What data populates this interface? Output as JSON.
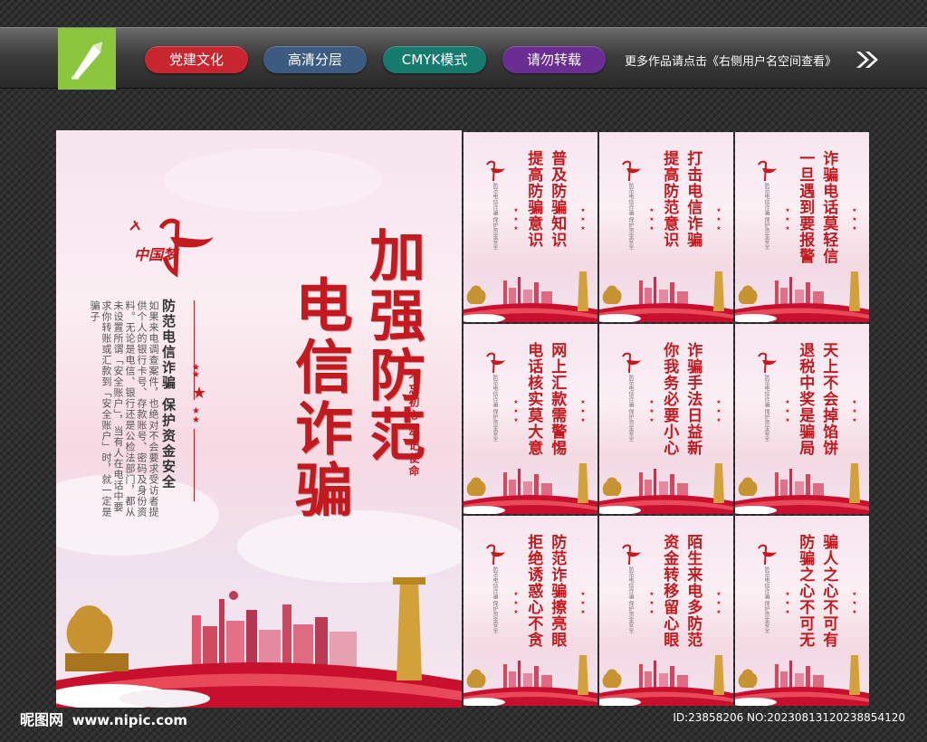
{
  "header": {
    "tags": [
      "党建文化",
      "高清分层",
      "CMYK模式",
      "请勿转载"
    ],
    "tip": "更多作品请点击《右侧用户名空间查看》"
  },
  "main_poster": {
    "logo_text": "中国梦",
    "title_line1": "加强防范",
    "title_line2": "电信诈骗",
    "subtitle": "防范电信诈骗 保护资金安全",
    "body": "如果来电调查案件，也绝对不会要求受访者提供个人的银行卡号、存款账号、密码及身份资料。无论是电信、银行还是公检法部门，都从未设置所谓「安全账户」，当有人在电话中要求你转账或汇款到「安全账户」时，就一定是骗子",
    "slogan": "不忘初心 牢记使命"
  },
  "mini_posters": [
    {
      "line1": "普及防骗知识",
      "line2": "提高防骗意识"
    },
    {
      "line1": "打击电信诈骗",
      "line2": "提高防范意识"
    },
    {
      "line1": "诈骗电话莫轻信",
      "line2": "一旦遇到要报警"
    },
    {
      "line1": "网上汇款需警惕",
      "line2": "电话核实莫大意"
    },
    {
      "line1": "诈骗手法日益新",
      "line2": "你我务必要小心"
    },
    {
      "line1": "天上不会掉馅饼",
      "line2": "退税中奖是骗局"
    },
    {
      "line1": "防范诈骗擦亮眼",
      "line2": "拒绝诱惑心不贪"
    },
    {
      "line1": "陌生来电多防范",
      "line2": "资金转移留心眼"
    },
    {
      "line1": "骗人之心不可有",
      "line2": "防骗之心不可无"
    }
  ],
  "mini_small_text": "防范电信诈骗 保护资金安全",
  "footer": {
    "brand": "昵图网",
    "site": "www.nipic.com",
    "id": "ID:23858206 NO:20230813120238854120"
  },
  "colors": {
    "accent_red": "#c21a1e",
    "tag_red": "#c8262e",
    "tag_blue": "#3d5a80",
    "tag_teal": "#167a6e",
    "tag_purple": "#6a2d91",
    "logo_green": "#8cc63f"
  },
  "icons": {
    "logo": "pen-nib-icon",
    "more": "double-chevron-right-icon"
  }
}
